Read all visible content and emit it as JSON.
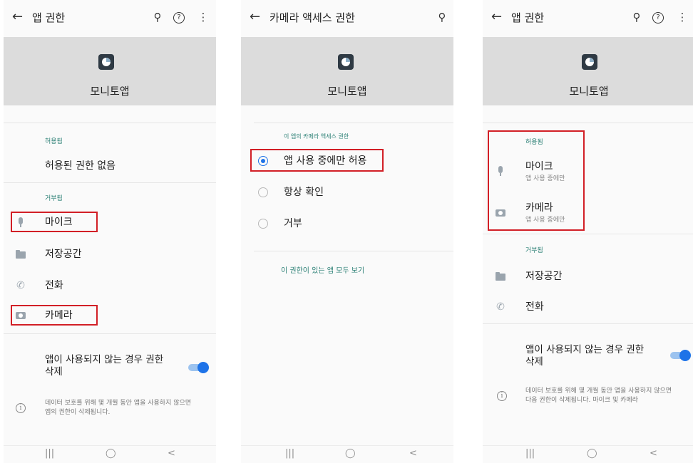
{
  "screen1": {
    "back": "←",
    "title": "앱 권한",
    "search_icon": "⚲",
    "help_icon": "?",
    "more_icon": "⋮",
    "app_name": "모니토앱",
    "allowed_header": "허용됨",
    "no_permission": "허용된 권한 없음",
    "denied_header": "거부됨",
    "denied_items": [
      "마이크",
      "저장공간",
      "전화",
      "카메라"
    ],
    "toggle_label_line1": "앱이 사용되지 않는 경우 권한",
    "toggle_label_line2": "삭제",
    "info_line1": "데이터 보호를 위해 몇 개월 동안 앱을 사용하지 않으면",
    "info_line2": "앱의 권한이 삭제됩니다.",
    "toggle_on": true
  },
  "screen2": {
    "back": "←",
    "title": "카메라 액세스 권한",
    "search_icon": "⚲",
    "app_name": "모니토앱",
    "section_header": "이 앱의 카메라 액세스 권한",
    "options": [
      "앱 사용 중에만 허용",
      "항상 확인",
      "거부"
    ],
    "selected_index": 0,
    "link": "이 권한이 있는 앱 모두 보기"
  },
  "screen3": {
    "back": "←",
    "title": "앱 권한",
    "search_icon": "⚲",
    "help_icon": "?",
    "more_icon": "⋮",
    "app_name": "모니토앱",
    "allowed_header": "허용됨",
    "allowed_items": [
      {
        "label": "마이크",
        "sub": "앱 사용 중에만"
      },
      {
        "label": "카메라",
        "sub": "앱 사용 중에만"
      }
    ],
    "denied_header": "거부됨",
    "denied_items": [
      "저장공간",
      "전화"
    ],
    "toggle_label_line1": "앱이 사용되지 않는 경우 권한",
    "toggle_label_line2": "삭제",
    "info_line1": "데이터 보호를 위해 몇 개월 동안 앱을 사용하지 않으면",
    "info_line2": "다음 권한이 삭제됩니다. 마이크 및 카메라",
    "toggle_on": true
  },
  "navbar": {
    "recents": "|||",
    "home": "◯",
    "back": "<"
  },
  "colors": {
    "accent": "#1e73e8",
    "section_text": "#2a7f74",
    "highlight_box": "#d21f26",
    "header_bg": "#dcdcdc"
  }
}
